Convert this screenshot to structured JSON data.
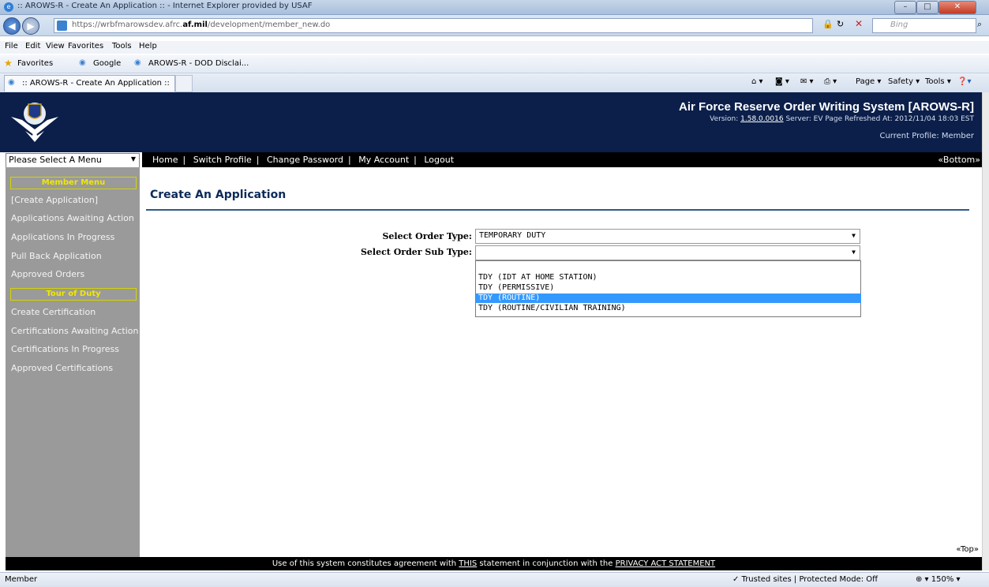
{
  "browser": {
    "window_title": ":: AROWS-R - Create An Application :: - Internet Explorer provided by USAF",
    "url_prefix": "https://wrbfmarowsdev.afrc.",
    "url_bold": "af.mil",
    "url_suffix": "/development/member_new.do",
    "search_placeholder": "Bing",
    "menus": [
      "File",
      "Edit",
      "View",
      "Favorites",
      "Tools",
      "Help"
    ],
    "favorites_label": "Favorites",
    "fav_links": [
      "Google",
      "AROWS-R - DOD Disclai..."
    ],
    "tab_title": ":: AROWS-R - Create An Application ::",
    "tools": [
      "Page ▾",
      "Safety ▾",
      "Tools ▾"
    ],
    "status_left": "Member",
    "status_zone": "✓ Trusted sites | Protected Mode: Off",
    "zoom": "150%"
  },
  "header": {
    "title": "Air Force Reserve Order Writing System [AROWS-R]",
    "version_label": "Version:",
    "version": "1.58.0.0016",
    "server_info": "Server: EV   Page Refreshed At: 2012/11/04 18:03 EST",
    "profile": "Current Profile: Member"
  },
  "nav": {
    "menu_select": "Please Select A Menu",
    "items": [
      "Home",
      "Switch Profile",
      "Change Password",
      "My Account",
      "Logout"
    ],
    "bottom_link": "«Bottom»"
  },
  "sidebar": {
    "member_heading": "Member Menu",
    "member_items": [
      "[Create Application]",
      "Applications Awaiting Action",
      "Applications In Progress",
      "Pull Back Application",
      "Approved Orders"
    ],
    "tour_heading": "Tour of Duty",
    "tour_items": [
      "Create Certification",
      "Certifications Awaiting Action",
      "Certifications In Progress",
      "Approved Certifications"
    ]
  },
  "main": {
    "title": "Create An Application",
    "order_type_label": "Select Order Type:",
    "order_type_value": "TEMPORARY DUTY",
    "order_subtype_label": "Select Order Sub Type:",
    "order_subtype_value": "",
    "subtype_options": [
      "",
      "TDY (IDT AT HOME STATION)",
      "TDY (PERMISSIVE)",
      "TDY (ROUTINE)",
      "TDY (ROUTINE/CIVILIAN TRAINING)"
    ],
    "highlighted_option": "TDY (ROUTINE)",
    "top_link": "«Top»"
  },
  "footer": {
    "pre": "Use of this system constitutes agreement with ",
    "this_link": "THIS",
    "mid": " statement in conjunction with the ",
    "privacy_link": "PRIVACY ACT STATEMENT"
  },
  "colors": {
    "banner": "#0b1f4a",
    "sidebar": "#9a9a9a",
    "sidebar_heading": "#f0e800",
    "highlight": "#3399ff"
  }
}
